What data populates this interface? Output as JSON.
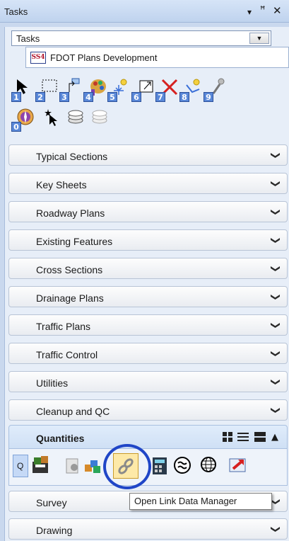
{
  "window": {
    "title": "Tasks",
    "controls": {
      "dropdown": "▾",
      "pin": "ꟸ",
      "close": "✕"
    }
  },
  "task_selector": {
    "value": "Tasks"
  },
  "subtask": {
    "logo_text": "SS4",
    "label": "FDOT Plans Development"
  },
  "toolbox": {
    "numbers": [
      "1",
      "2",
      "3",
      "4",
      "5",
      "6",
      "7",
      "8",
      "9",
      "0"
    ]
  },
  "sections": [
    {
      "label": "Typical Sections"
    },
    {
      "label": "Key Sheets"
    },
    {
      "label": "Roadway Plans"
    },
    {
      "label": "Existing Features"
    },
    {
      "label": "Cross Sections"
    },
    {
      "label": "Drainage Plans"
    },
    {
      "label": "Traffic Plans"
    },
    {
      "label": "Traffic Control"
    },
    {
      "label": "Utilities"
    },
    {
      "label": "Cleanup and QC"
    }
  ],
  "quantities": {
    "label": "Quantities",
    "q_key": "Q"
  },
  "sections_after": [
    {
      "label": "Survey"
    },
    {
      "label": "Drawing"
    }
  ],
  "tooltip": {
    "text": "Open Link Data Manager"
  },
  "colors": {
    "highlight_circle": "#2046c7",
    "key_badge": "#5a88d8"
  }
}
